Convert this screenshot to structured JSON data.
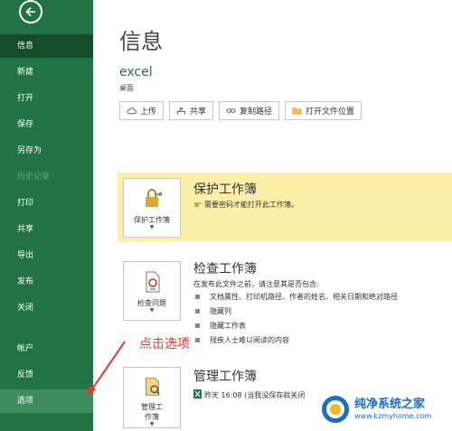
{
  "sidebar": {
    "items": [
      {
        "label": "信息",
        "state": "active"
      },
      {
        "label": "新建",
        "state": "normal"
      },
      {
        "label": "打开",
        "state": "normal"
      },
      {
        "label": "保存",
        "state": "normal"
      },
      {
        "label": "另存为",
        "state": "normal"
      },
      {
        "label": "历史记录",
        "state": "disabled"
      },
      {
        "label": "打印",
        "state": "normal"
      },
      {
        "label": "共享",
        "state": "normal"
      },
      {
        "label": "导出",
        "state": "normal"
      },
      {
        "label": "发布",
        "state": "normal"
      },
      {
        "label": "关闭",
        "state": "normal"
      },
      {
        "label": "帐户",
        "state": "normal"
      },
      {
        "label": "反馈",
        "state": "normal"
      },
      {
        "label": "选项",
        "state": "hover"
      }
    ]
  },
  "main": {
    "title": "信息",
    "file_name": "excel",
    "file_path": "桌面",
    "buttons": {
      "upload": "上传",
      "share": "共享",
      "copy_path": "复制路径",
      "open_location": "打开文件位置"
    },
    "protect": {
      "button_label": "保护工作簿",
      "title": "保护工作簿",
      "desc": "需要密码才能打开此工作簿。"
    },
    "inspect": {
      "button_label": "检查问题",
      "title": "检查工作簿",
      "desc": "在发布此文件之前，请注意其是否包含:",
      "bullets": [
        "文档属性、打印机路径、作者的姓名、相关日期和绝对路径",
        "隐藏列",
        "隐藏工作表",
        "残疾人士难以阅读的内容"
      ]
    },
    "manage": {
      "button_label_1": "管理工",
      "button_label_2": "作簿",
      "title": "管理工作簿",
      "desc": "昨天 16:08 (当我没保存就关闭"
    }
  },
  "annotation": {
    "text": "点击选项"
  },
  "watermark": {
    "name": "纯净系统之家",
    "url": "www.kzmyhome.com"
  },
  "colors": {
    "sidebar": "#217346",
    "active": "#134d2b",
    "highlight": "#fcf0a9",
    "annotation": "#e8382c"
  }
}
